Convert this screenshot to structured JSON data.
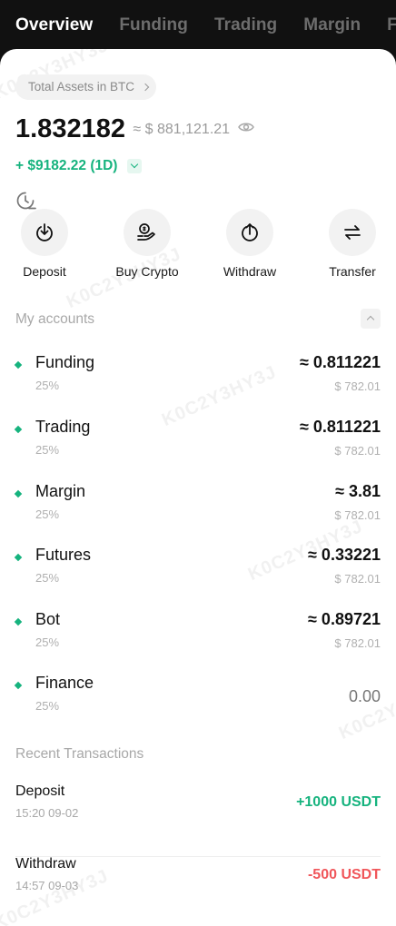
{
  "tabs": [
    "Overview",
    "Funding",
    "Trading",
    "Margin",
    "Futu"
  ],
  "watermark": "K0C2Y3HY3J",
  "summary": {
    "chip_label": "Total Assets in BTC",
    "balance": "1.832182",
    "fiat": "≈ $ 881,121.21",
    "pnl": "+ $9182.22 (1D)"
  },
  "actions": [
    "Deposit",
    "Buy Crypto",
    "Withdraw",
    "Transfer"
  ],
  "accounts_title": "My accounts",
  "accounts": [
    {
      "name": "Funding",
      "pct": "25%",
      "amount": "≈ 0.811221",
      "fiat": "$ 782.01"
    },
    {
      "name": "Trading",
      "pct": "25%",
      "amount": "≈ 0.811221",
      "fiat": "$ 782.01"
    },
    {
      "name": "Margin",
      "pct": "25%",
      "amount": "≈ 3.81",
      "fiat": "$ 782.01"
    },
    {
      "name": "Futures",
      "pct": "25%",
      "amount": "≈ 0.33221",
      "fiat": "$ 782.01"
    },
    {
      "name": "Bot",
      "pct": "25%",
      "amount": "≈ 0.89721",
      "fiat": "$ 782.01"
    },
    {
      "name": "Finance",
      "pct": "25%",
      "amount": "0.00",
      "fiat": ""
    }
  ],
  "transactions_title": "Recent Transactions",
  "transactions": [
    {
      "type": "Deposit",
      "time": "15:20 09-02",
      "amount": "+1000 USDT"
    },
    {
      "type": "Withdraw",
      "time": "14:57 09-03",
      "amount": "-500 USDT"
    }
  ],
  "colors": {
    "positive": "#16b37e",
    "negative": "#f0565a",
    "accent": "#16b37e"
  }
}
